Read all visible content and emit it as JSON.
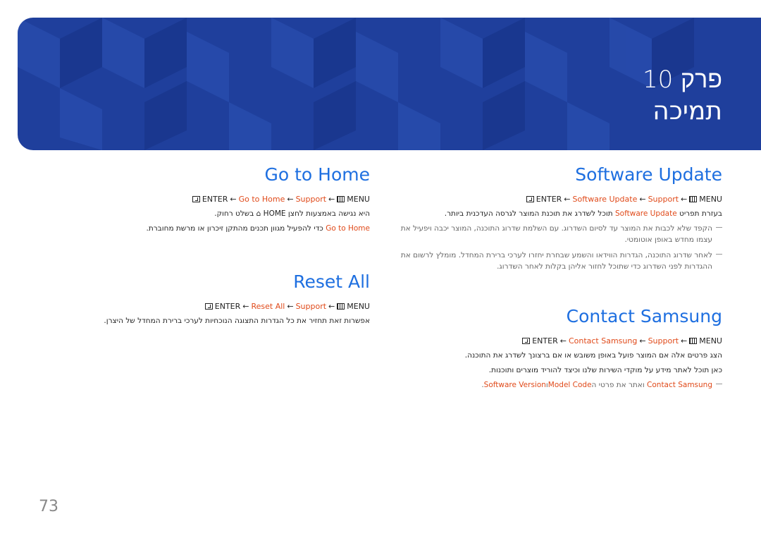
{
  "header": {
    "chapter": "פרק 10",
    "title": "תמיכה",
    "colors": {
      "banner": "#1f3f9c",
      "heading": "#1e6fe0",
      "highlight": "#e04a1a"
    }
  },
  "software_update": {
    "heading": "Software Update",
    "menu": {
      "menu": "MENU",
      "support": "Support",
      "item": "Software Update",
      "enter": "ENTER",
      "arrow": "←"
    },
    "desc": [
      "בעזרת תפריט ",
      "Software Update",
      " תוכל לשדרג את תוכנת המוצר לגרסה העדכנית ביותר."
    ],
    "notes": [
      "הקפד שלא לכבות את המוצר עד לסיום השדרוג. עם השלמת שדרוג התוכנה, המוצר יכבה ויפעיל את עצמו מחדש באופן אוטומטי.",
      "לאחר שדרוג התוכנה, הגדרות הווידאו והשמע שבחרת יחזרו לערכי ברירת המחדל. מומלץ לרשום את ההגדרות לפני השדרוג כדי שתוכל לחזור אליהן בקלות לאחר השדרוג."
    ]
  },
  "contact_samsung": {
    "heading": "Contact Samsung",
    "menu": {
      "menu": "MENU",
      "support": "Support",
      "item": "Contact Samsung",
      "enter": "ENTER",
      "arrow": "←"
    },
    "lines": [
      "הצג פרטים אלה אם המוצר פועל באופן משובש או אם ברצונך לשדרג את התוכנה.",
      "כאן תוכל לאתר מידע על מוקדי השירות שלנו וכיצד להוריד מוצרים ותוכנות."
    ],
    "note": [
      "Contact Samsung",
      " ואתר את פרטי ה",
      "Model Code",
      "ו",
      "Software Version",
      "."
    ]
  },
  "go_to_home": {
    "heading": "Go to Home",
    "menu": {
      "menu": "MENU",
      "support": "Support",
      "item": "Go to Home",
      "enter": "ENTER",
      "arrow": "←"
    },
    "line1": [
      "היא נגישה באמצעות לחצן HOME ",
      "⌂",
      " בשלט רחוק."
    ],
    "line2": [
      "Go to Home",
      " כדי להפעיל מגוון תכנים מהתקן זיכרון או מרשת מחוברת."
    ]
  },
  "reset_all": {
    "heading": "Reset All",
    "menu": {
      "menu": "MENU",
      "support": "Support",
      "item": "Reset All",
      "enter": "ENTER",
      "arrow": "←"
    },
    "line": "אפשרות זאת תחזיר את כל הגדרות התצוגה הנוכחיות לערכי ברירת המחדל של היצרן."
  },
  "page_number": "73"
}
